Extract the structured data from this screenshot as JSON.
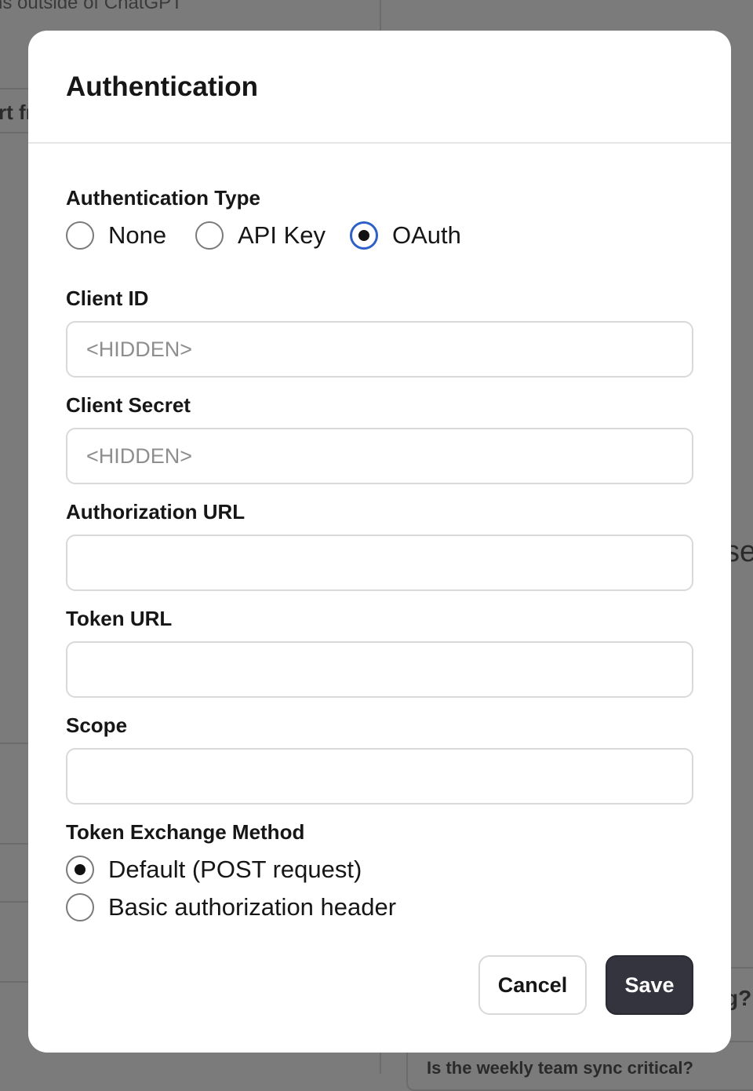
{
  "background": {
    "top_text": "ns outside of ChatGPT",
    "left_fragment": "rt fr",
    "right_fragment": "se",
    "right_question": "g?",
    "bottom_card_text": "Is the weekly team sync critical?"
  },
  "modal": {
    "title": "Authentication",
    "auth_type": {
      "label": "Authentication Type",
      "options": [
        "None",
        "API Key",
        "OAuth"
      ],
      "selected": "OAuth"
    },
    "client_id": {
      "label": "Client ID",
      "placeholder": "<HIDDEN>",
      "value": ""
    },
    "client_secret": {
      "label": "Client Secret",
      "placeholder": "<HIDDEN>",
      "value": ""
    },
    "authorization_url": {
      "label": "Authorization URL",
      "value": ""
    },
    "token_url": {
      "label": "Token URL",
      "value": ""
    },
    "scope": {
      "label": "Scope",
      "value": ""
    },
    "token_exchange": {
      "label": "Token Exchange Method",
      "options": [
        "Default (POST request)",
        "Basic authorization header"
      ],
      "selected": "Default (POST request)"
    },
    "buttons": {
      "cancel": "Cancel",
      "save": "Save"
    }
  },
  "colors": {
    "overlay": "#7b7b7b",
    "focus_ring": "#2f5fc9",
    "save_button": "#34343f"
  }
}
